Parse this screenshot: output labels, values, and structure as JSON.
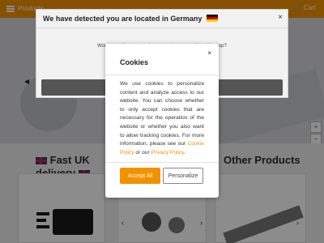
{
  "header": {
    "menu_label": "Products",
    "search_placeholder": "Search...",
    "cart_label": "Cart"
  },
  "sections": {
    "left_heading_line1": "Fast UK",
    "left_heading_line2": "delivery",
    "right_heading": "Other Products"
  },
  "geo_modal": {
    "title": "We have detected you are located in Germany",
    "close_glyph": "×",
    "question": "Would you like to be redirected to the correct Motedis shop?"
  },
  "cookie_modal": {
    "title": "Cookies",
    "close_glyph": "×",
    "body_text": "We use cookies to personalize content and analyze access to our website. You can choose whether to only accept cookies that are necessary for the operation of the website or whether you also want to allow tracking cookies. For more information, please see our",
    "link1": "Cookie Policy",
    "link_joiner": " or our ",
    "link2": "Privacy Policy",
    "end": ".",
    "accept_label": "Accept All",
    "personalize_label": "Personalize"
  },
  "colors": {
    "brand_orange": "#f39200",
    "overlay": "rgba(0,0,0,0.45)"
  }
}
